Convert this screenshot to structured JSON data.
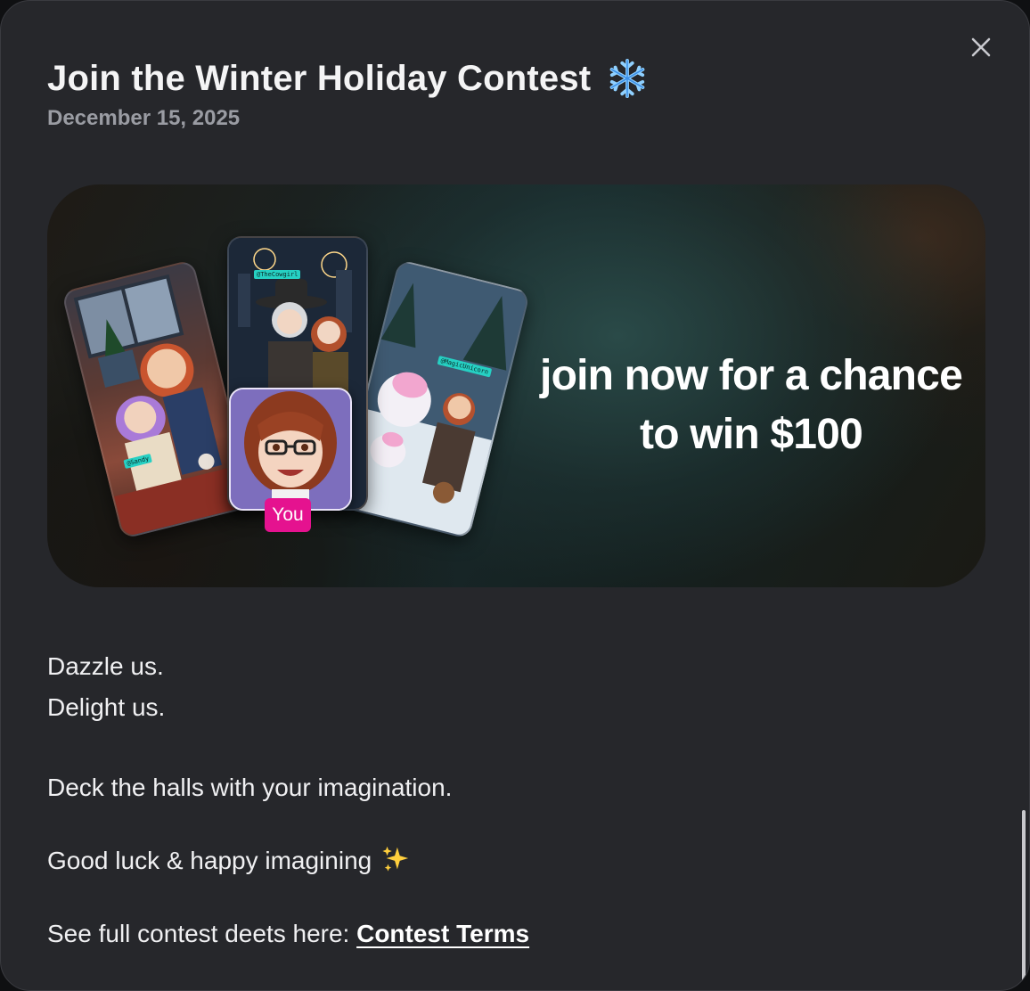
{
  "modal": {
    "title": "Join the Winter Holiday Contest",
    "title_icon": "snowflake-icon",
    "date": "December 15, 2025",
    "close_icon": "close-icon"
  },
  "banner": {
    "headline_line1": "join now for a chance",
    "headline_line2": "to win $100",
    "cards": {
      "left_tag": "@Sandy",
      "center_tag": "@TheCowgirl",
      "right_tag": "@MagicUnicorn"
    },
    "you_badge": "You",
    "you_badge_color": "#e5128f"
  },
  "body": {
    "line1": "Dazzle us.",
    "line2": "Delight us.",
    "line3": "Deck the halls with your imagination.",
    "line4": "Good luck & happy imagining",
    "line4_icon": "sparkles-icon",
    "line5_prefix": "See full contest deets here: ",
    "link_label": "Contest Terms"
  },
  "colors": {
    "background": "#26272b",
    "text": "#f0f0f2",
    "muted": "#9a9ca3",
    "tag": "#26d0c3"
  }
}
